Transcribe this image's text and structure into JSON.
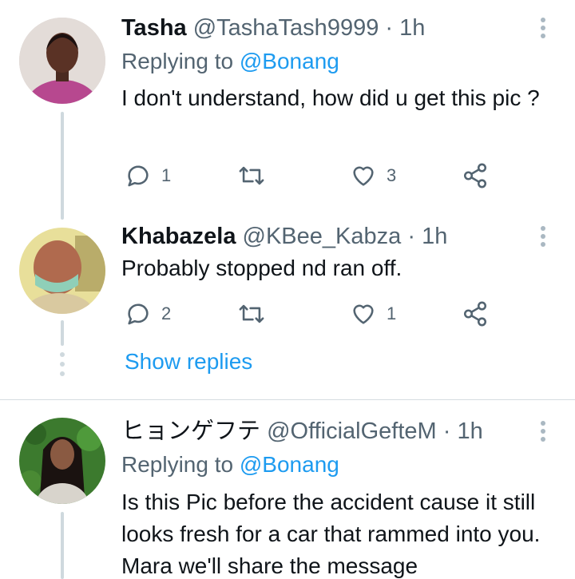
{
  "tweets": [
    {
      "name": "Tasha",
      "handle": "@TashaTash9999",
      "separator": "·",
      "time": "1h",
      "replying_prefix": "Replying to",
      "replying_to": "@Bonang",
      "text": "I don't understand, how did u get this pic ?",
      "replies": "1",
      "retweets": "",
      "likes": "3",
      "avatar": "avatar-photo-woman"
    },
    {
      "name": "Khabazela",
      "handle": "@KBee_Kabza",
      "separator": "·",
      "time": "1h",
      "text": "Probably stopped nd ran off.",
      "replies": "2",
      "retweets": "",
      "likes": "1",
      "avatar": "avatar-photo-man"
    },
    {
      "name": "ヒョンゲフテ",
      "handle": "@OfficialGefteM",
      "separator": "·",
      "time": "1h",
      "replying_prefix": "Replying to",
      "replying_to": "@Bonang",
      "text": "Is this Pic before the accident cause it still looks fresh for a car that rammed into you. Mara we'll share the message",
      "avatar": "avatar-photo-woman-greenery"
    }
  ],
  "show_replies_label": "Show replies",
  "icons": {
    "reply": "reply-icon",
    "retweet": "retweet-icon",
    "like": "heart-icon",
    "share": "share-icon",
    "more": "more-vertical-icon"
  },
  "colors": {
    "accent": "#1d9bf0",
    "secondary_text": "#536471",
    "thread_line": "#cfd9de"
  }
}
